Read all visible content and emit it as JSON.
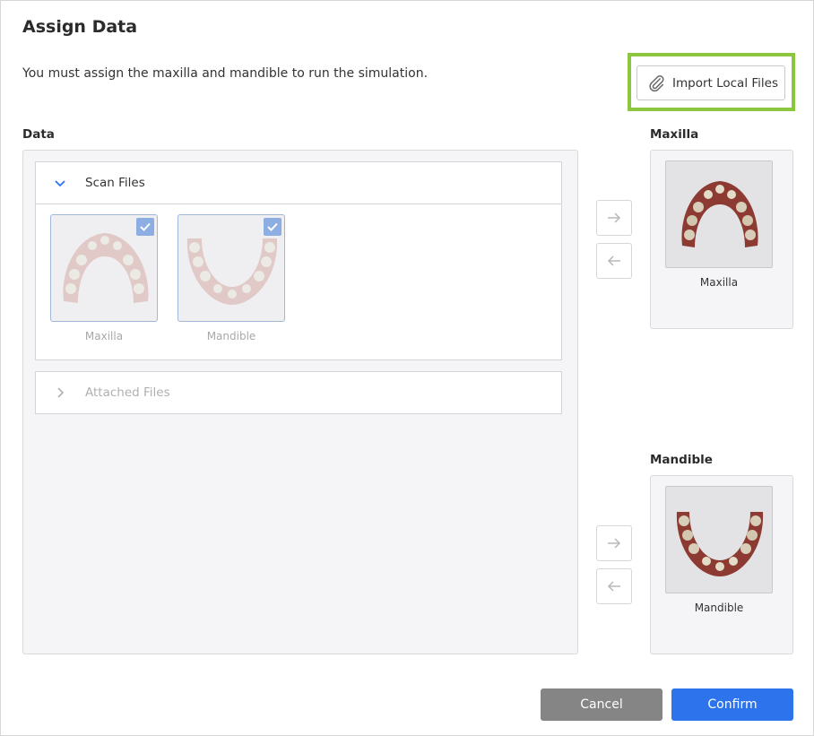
{
  "dialog": {
    "title": "Assign Data",
    "description": "You must assign the maxilla and mandible to run the simulation.",
    "import_label": "Import Local Files"
  },
  "data_panel": {
    "label": "Data",
    "groups": [
      {
        "title": "Scan Files",
        "expanded": true,
        "items": [
          {
            "label": "Maxilla",
            "checked": true
          },
          {
            "label": "Mandible",
            "checked": true
          }
        ]
      },
      {
        "title": "Attached Files",
        "expanded": false
      }
    ]
  },
  "slots": {
    "maxilla": {
      "heading": "Maxilla",
      "item_label": "Maxilla"
    },
    "mandible": {
      "heading": "Mandible",
      "item_label": "Mandible"
    }
  },
  "footer": {
    "cancel_label": "Cancel",
    "confirm_label": "Confirm"
  },
  "colors": {
    "accent": "#2d73ec",
    "highlight": "#8cc63f",
    "check": "#8daee2",
    "cancel": "#858585"
  }
}
